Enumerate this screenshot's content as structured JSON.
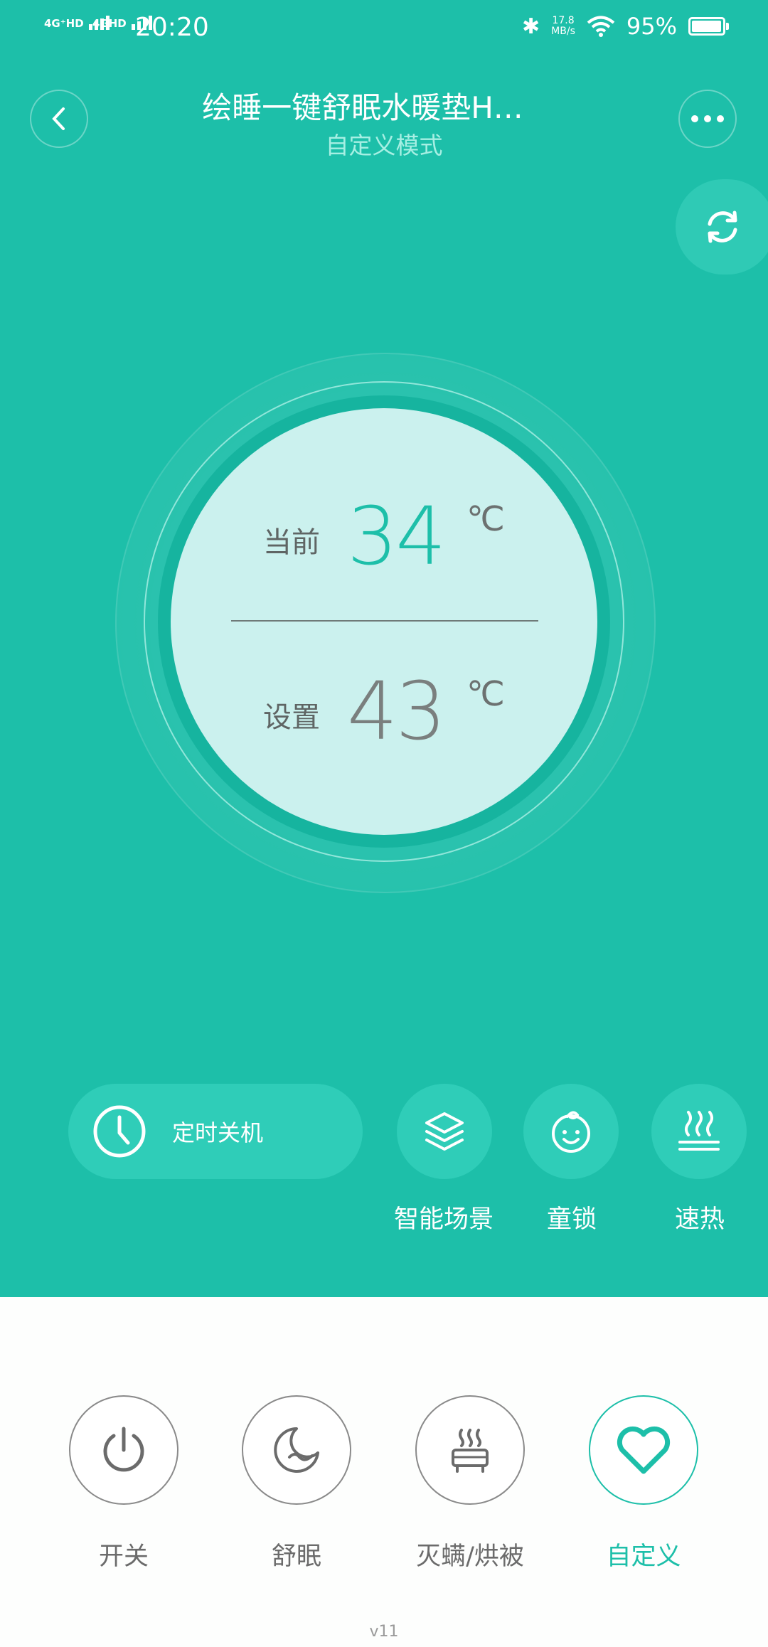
{
  "status_bar": {
    "signal1": "4G⁺HD",
    "signal2": "4GHD",
    "time": "20:20",
    "net_speed_value": "17.8",
    "net_speed_unit": "MB/s",
    "battery": "95%",
    "battery_level": 0.95
  },
  "header": {
    "title": "绘睡一键舒眠水暖垫H…",
    "subtitle": "自定义模式"
  },
  "gauge": {
    "current_label": "当前",
    "current_value": "34",
    "current_unit": "℃",
    "set_label": "设置",
    "set_value": "43",
    "set_unit": "℃"
  },
  "controls": {
    "timer_label": "定时关机",
    "scene_label": "智能场景",
    "child_lock_label": "童锁",
    "quick_heat_label": "速热"
  },
  "modes": [
    {
      "label": "开关",
      "icon": "power-icon",
      "active": false
    },
    {
      "label": "舒眠",
      "icon": "moon-sleep-icon",
      "active": false
    },
    {
      "label": "灭螨/烘被",
      "icon": "heater-icon",
      "active": false
    },
    {
      "label": "自定义",
      "icon": "heart-icon",
      "active": true
    }
  ],
  "version": "v11",
  "colors": {
    "primary": "#1dbfa9",
    "gauge_fill": "#cbf1ee",
    "current_value_color": "#1dbfa9",
    "set_value_color": "#7a7f7e"
  }
}
